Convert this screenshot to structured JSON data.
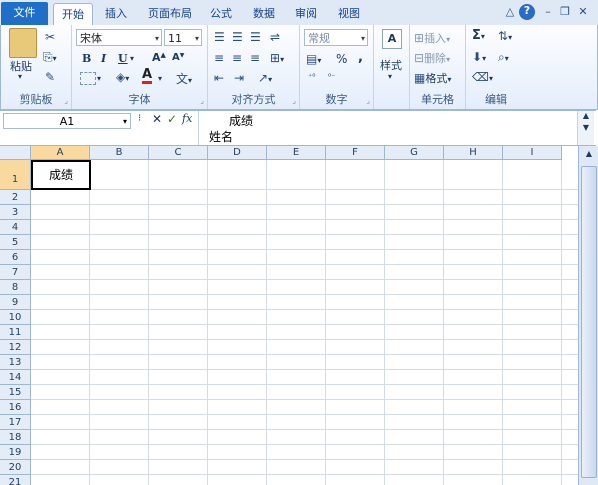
{
  "tabs": [
    "文件",
    "开始",
    "插入",
    "页面布局",
    "公式",
    "数据",
    "审阅",
    "视图"
  ],
  "ribbon": {
    "paste_label": "粘贴",
    "clipboard_label": "剪贴板",
    "font_name": "宋体",
    "font_size": "11",
    "font_label": "字体",
    "align_label": "对齐方式",
    "number_format": "常规",
    "number_label": "数字",
    "styles_label": "样式",
    "insert_label": "插入",
    "delete_label": "删除",
    "format_label": "格式",
    "cells_label": "单元格",
    "editing_label": "编辑",
    "bold": "B",
    "italic": "I",
    "underline": "U",
    "percent": "%",
    "comma": ","
  },
  "formula_bar": {
    "name_box": "A1",
    "fx": "fx",
    "line1": "成绩",
    "line2": "姓名"
  },
  "columns": [
    "A",
    "B",
    "C",
    "D",
    "E",
    "F",
    "G",
    "H",
    "I"
  ],
  "rows": [
    "1",
    "2",
    "3",
    "4",
    "5",
    "6",
    "7",
    "8",
    "9",
    "10",
    "11",
    "12",
    "13",
    "14",
    "15",
    "16",
    "17",
    "18",
    "19",
    "20",
    "21"
  ],
  "cells": {
    "A1": "成绩"
  }
}
